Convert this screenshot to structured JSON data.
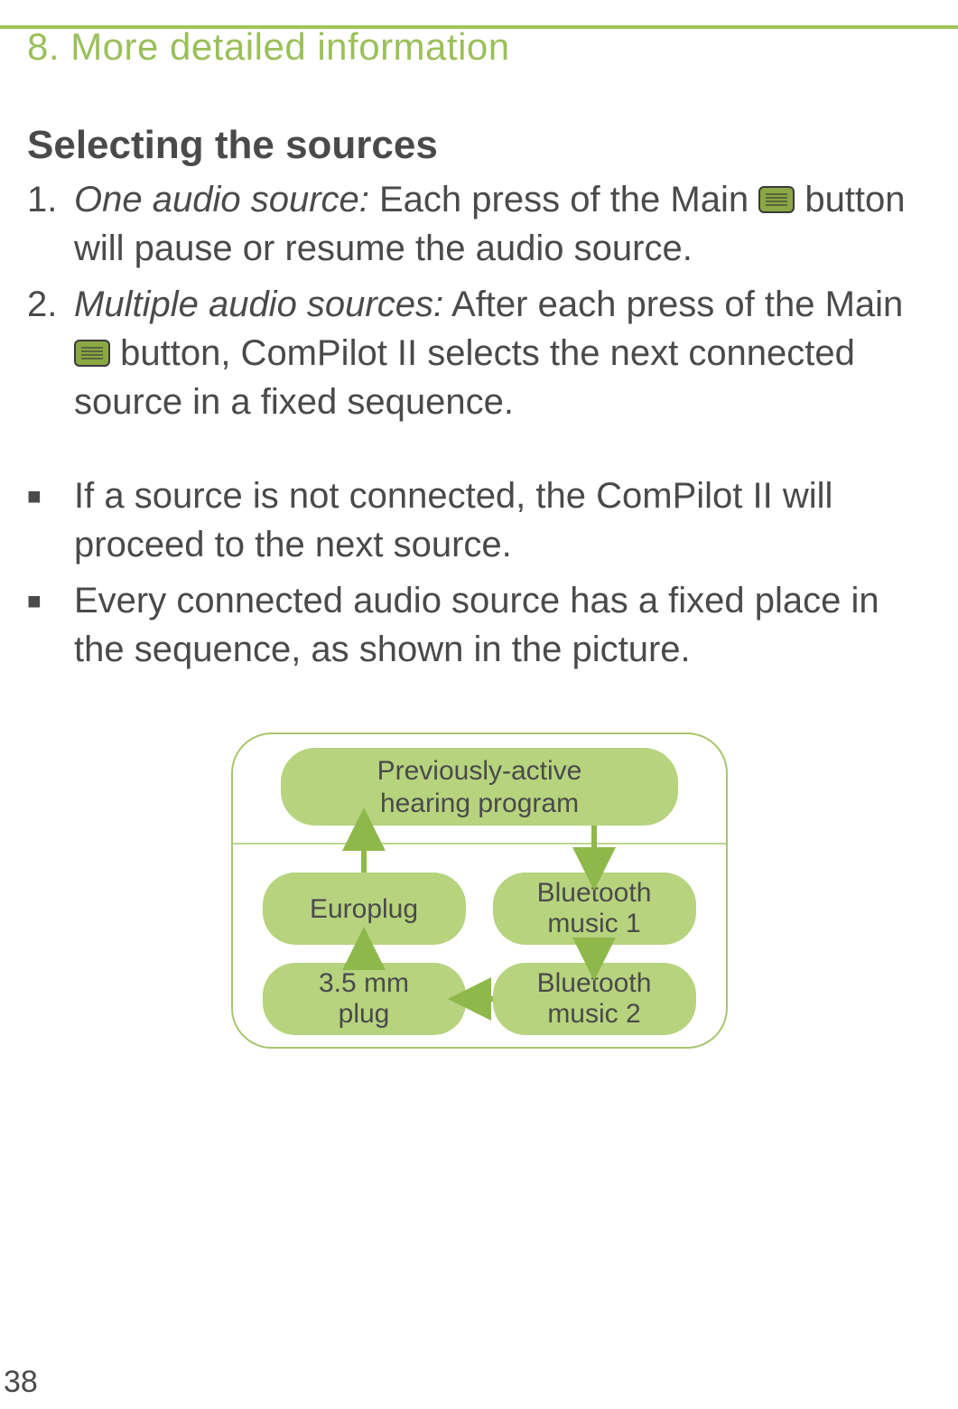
{
  "chapter": "8. More detailed information",
  "section_title": "Selecting the sources",
  "ordered": [
    {
      "num": "1.",
      "lead": "One audio source:",
      "rest_a": " Each press of the Main ",
      "rest_b": " button will pause or resume the audio source."
    },
    {
      "num": "2.",
      "lead": "Multiple audio sources:",
      "rest_a": " After each press of the Main ",
      "rest_b": " button, ComPilot II selects the next connected source in a fixed sequence."
    }
  ],
  "bulleted": [
    "If a source is not connected, the ComPilot II will proceed to the next source.",
    "Every connected audio source has a fixed place in the sequence, as shown in the picture."
  ],
  "diagram": {
    "top": "Previously-active hearing program",
    "europlug": "Europlug",
    "bt1": "Bluetooth music 1",
    "plug35": "3.5 mm plug",
    "bt2": "Bluetooth music 2"
  },
  "page_number": "38"
}
